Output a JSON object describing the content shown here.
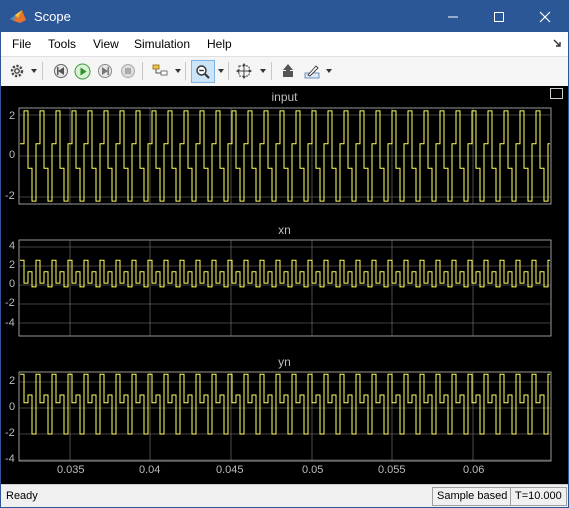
{
  "window": {
    "title": "Scope",
    "icon": "matlab-scope-icon"
  },
  "menu": [
    "File",
    "Tools",
    "View",
    "Simulation",
    "Help"
  ],
  "toolbar": {
    "icons": [
      "gear-icon",
      "step-back-icon",
      "run-icon",
      "stop-icon",
      "signal-select-icon",
      "zoom-icon",
      "autoscale-icon",
      "write-icon",
      "highlight-icon"
    ]
  },
  "plots": [
    {
      "title": "input",
      "yticks": [
        "2",
        "0",
        "-2"
      ]
    },
    {
      "title": "xn",
      "yticks": [
        "4",
        "2",
        "0",
        "-2",
        "-4"
      ]
    },
    {
      "title": "yn",
      "yticks": [
        "2",
        "0",
        "-2",
        "-4"
      ]
    }
  ],
  "xticks": [
    "0.035",
    "0.04",
    "0.045",
    "0.05",
    "0.055",
    "0.06"
  ],
  "status": {
    "text": "Ready",
    "mode": "Sample based",
    "time": "T=10.000"
  },
  "colors": {
    "trace": "#ffff5a",
    "grid": "#7f7f7f",
    "axes_bg": "#000000",
    "titlebar": "#2b5797"
  }
}
